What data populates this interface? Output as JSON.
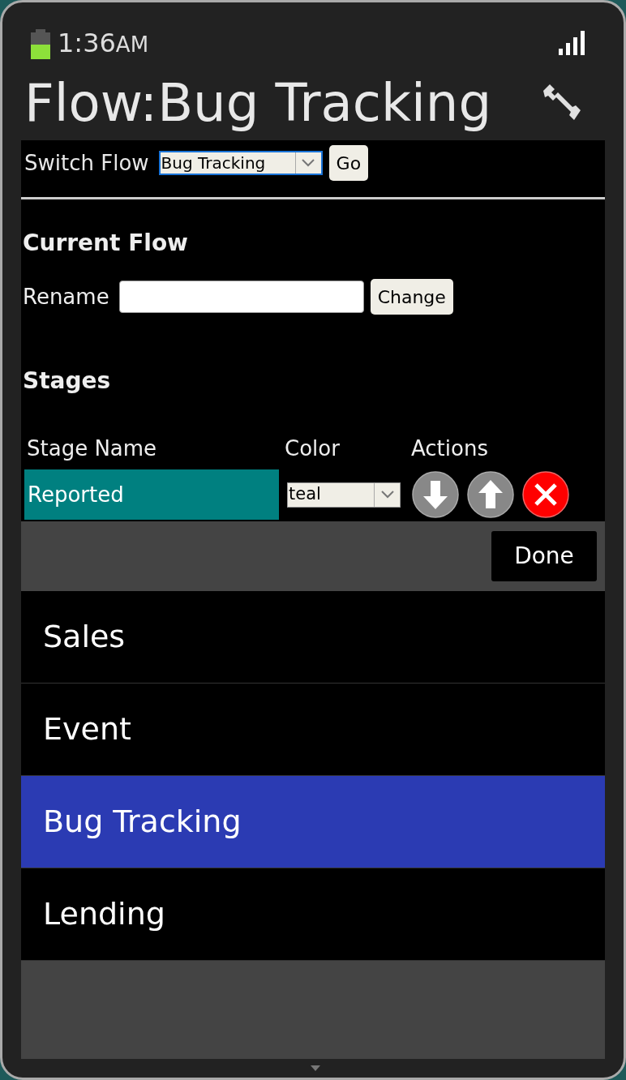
{
  "status_bar": {
    "time": "1:36",
    "time_suffix": "AM"
  },
  "title": "Flow:Bug Tracking",
  "switch_flow": {
    "label": "Switch Flow",
    "select_value": "Bug Tracking",
    "go_button": "Go"
  },
  "current_flow": {
    "heading": "Current Flow",
    "rename_label": "Rename",
    "change_button": "Change"
  },
  "stages": {
    "heading": "Stages",
    "columns": [
      "Stage Name",
      "Color",
      "Actions"
    ],
    "rows": [
      {
        "name": "Reported",
        "color": "#008080",
        "color_value": "teal"
      }
    ]
  },
  "picker": {
    "done_button": "Done",
    "options": [
      {
        "label": "Sales",
        "selected": false
      },
      {
        "label": "Event",
        "selected": false
      },
      {
        "label": "Bug Tracking",
        "selected": true
      },
      {
        "label": "Lending",
        "selected": false
      }
    ]
  }
}
